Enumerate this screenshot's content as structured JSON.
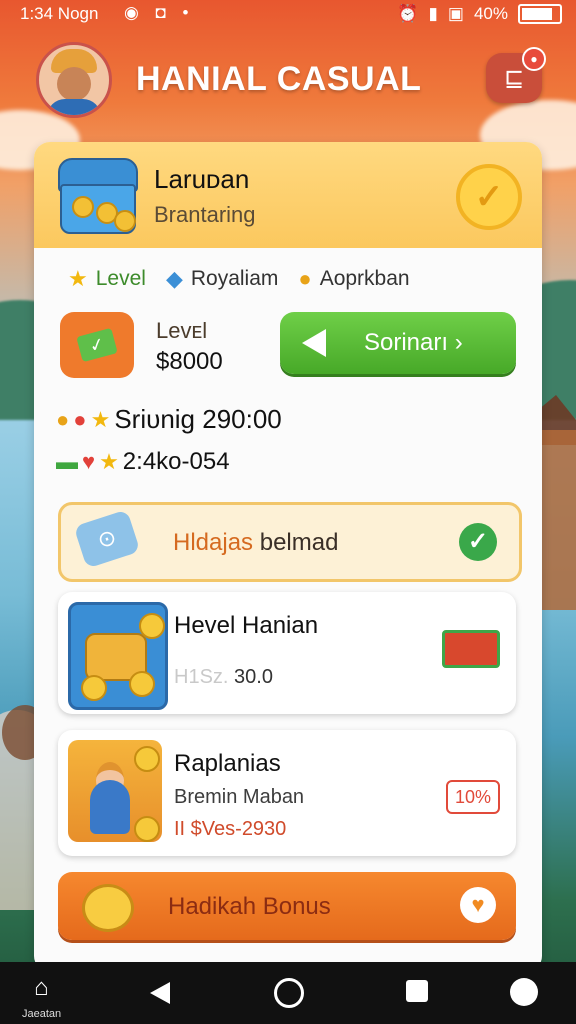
{
  "status_bar": {
    "time": "1:34 Nogn",
    "battery": "40%"
  },
  "header": {
    "title": "HANIAL CASUAL"
  },
  "card_header": {
    "title": "Laruᴅan",
    "subtitle": "Brantaring"
  },
  "tabs": [
    {
      "icon": "star-icon",
      "label": "Level"
    },
    {
      "icon": "gem-icon",
      "label": "Royaliam"
    },
    {
      "icon": "coin-icon",
      "label": "Aoprkban"
    }
  ],
  "level": {
    "label": "Levᴇl",
    "value": "$8000"
  },
  "sorted_button": {
    "label": "Sorinarı ›"
  },
  "stats": [
    {
      "icons": [
        "coin-icon",
        "map-pin-icon",
        "star-icon"
      ],
      "text": "Sriᴜnig 290:00"
    },
    {
      "icons": [
        "cash-icon",
        "heart-icon",
        "star-icon"
      ],
      "text": "2:4ko-054"
    }
  ],
  "hint": {
    "text_colored": "Hldajas",
    "text_plain": "belmad"
  },
  "items": [
    {
      "title": "Hevel Hanian",
      "sub_muted": "H1Sz.",
      "sub_value": "30.0"
    },
    {
      "title": "Raplanias",
      "sub": "Bremin Maban",
      "extra": "II $Ves-2930",
      "badge": "10%"
    }
  ],
  "bonus": {
    "label": "Hadikah Bonus"
  },
  "nav": {
    "home_label": "Jaeatan"
  },
  "colors": {
    "accent_orange": "#ef7a2c",
    "accent_green": "#47a928",
    "card_header": "#fbc85e"
  }
}
